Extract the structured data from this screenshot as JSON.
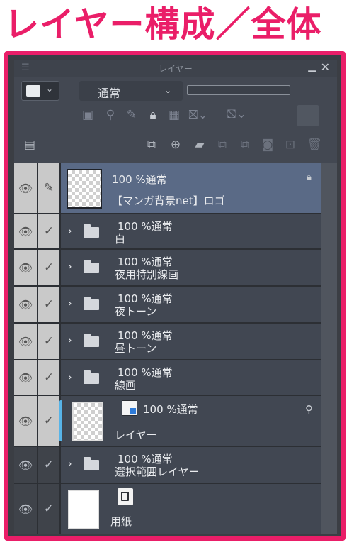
{
  "headline": "レイヤー構成／全体",
  "panel": {
    "title": "レイヤー",
    "blend_mode": "通常",
    "icons_row2": [
      "clipping-icon",
      "reference-layer-icon",
      "draft-layer-icon",
      "lock-icon",
      "lock-transparent-icon",
      "mask-enable-icon",
      "mask-range-icon",
      "palette-color-icon"
    ],
    "icons_row3": [
      "property-icon",
      "new-raster-layer-icon",
      "new-vector-layer-icon",
      "new-folder-icon",
      "transfer-down-icon",
      "combine-down-icon",
      "create-mask-icon",
      "apply-mask-icon",
      "delete-icon"
    ]
  },
  "layers": [
    {
      "opacity": "100 %通常",
      "name": "【マンガ背景net】ロゴ",
      "type": "raster",
      "selected": true,
      "locked": true,
      "visible": true
    },
    {
      "opacity": "100 %通常",
      "name": "白",
      "type": "folder",
      "visible": true
    },
    {
      "opacity": "100 %通常",
      "name": "夜用特別線画",
      "type": "folder",
      "visible": true
    },
    {
      "opacity": "100 %通常",
      "name": "夜トーン",
      "type": "folder",
      "visible": true
    },
    {
      "opacity": "100 %通常",
      "name": "昼トーン",
      "type": "folder",
      "visible": true
    },
    {
      "opacity": "100 %通常",
      "name": "線画",
      "type": "folder",
      "visible": true
    },
    {
      "opacity": "100 %通常",
      "name": "レイヤー",
      "type": "raster",
      "visible": true
    },
    {
      "opacity": "100 %通常",
      "name": "選択範囲レイヤー",
      "type": "folder",
      "visible": false
    },
    {
      "opacity": "",
      "name": "用紙",
      "type": "paper",
      "visible": false
    }
  ],
  "colors": {
    "accent": "#ea1e68",
    "selected_row": "#5a6a86",
    "row": "#414752",
    "panel": "#434852"
  }
}
